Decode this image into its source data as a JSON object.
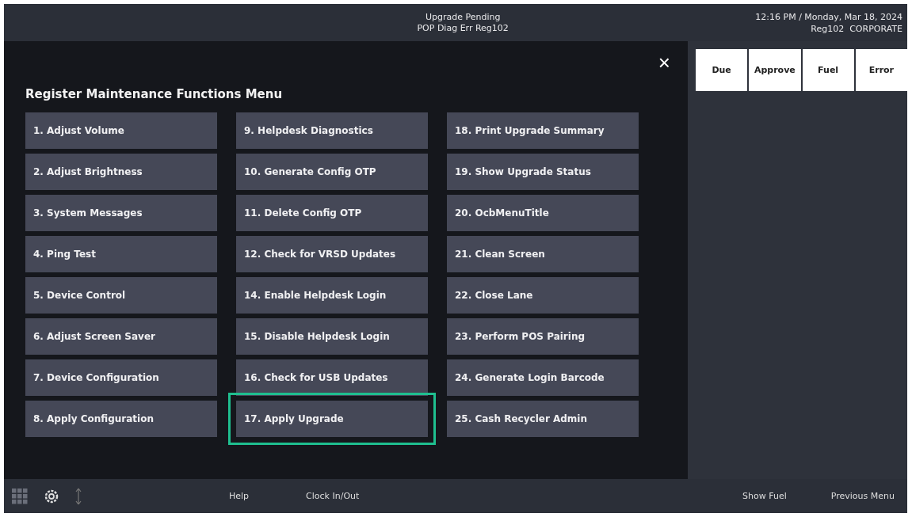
{
  "header": {
    "status_lines": [
      "Upgrade Pending",
      "POP Diag Err Reg102"
    ],
    "datetime": "12:16 PM / Monday, Mar 18, 2024",
    "register": "Reg102  CORPORATE"
  },
  "quick_buttons": [
    "Due",
    "Approve",
    "Fuel",
    "Error"
  ],
  "menu": {
    "title": "Register Maintenance Functions Menu",
    "close": "×",
    "columns": [
      [
        {
          "label": "1. Adjust Volume",
          "highlighted": false
        },
        {
          "label": "2. Adjust Brightness",
          "highlighted": false
        },
        {
          "label": "3. System Messages",
          "highlighted": false
        },
        {
          "label": "4. Ping Test",
          "highlighted": false
        },
        {
          "label": "5. Device Control",
          "highlighted": false
        },
        {
          "label": "6. Adjust Screen Saver",
          "highlighted": false
        },
        {
          "label": "7. Device Configuration",
          "highlighted": false
        },
        {
          "label": "8. Apply Configuration",
          "highlighted": false
        }
      ],
      [
        {
          "label": "9. Helpdesk Diagnostics",
          "highlighted": false
        },
        {
          "label": "10. Generate Config OTP",
          "highlighted": false
        },
        {
          "label": "11. Delete Config OTP",
          "highlighted": false
        },
        {
          "label": "12. Check for VRSD Updates",
          "highlighted": false
        },
        {
          "label": "14. Enable Helpdesk Login",
          "highlighted": false
        },
        {
          "label": "15. Disable Helpdesk Login",
          "highlighted": false
        },
        {
          "label": "16. Check for USB Updates",
          "highlighted": false
        },
        {
          "label": "17. Apply Upgrade",
          "highlighted": true
        }
      ],
      [
        {
          "label": "18. Print Upgrade Summary",
          "highlighted": false
        },
        {
          "label": "19. Show Upgrade Status",
          "highlighted": false
        },
        {
          "label": "20. OcbMenuTitle",
          "highlighted": false
        },
        {
          "label": "21. Clean Screen",
          "highlighted": false
        },
        {
          "label": "22. Close Lane",
          "highlighted": false
        },
        {
          "label": "23. Perform POS Pairing",
          "highlighted": false
        },
        {
          "label": "24. Generate Login Barcode",
          "highlighted": false
        },
        {
          "label": "25. Cash Recycler Admin",
          "highlighted": false
        }
      ]
    ]
  },
  "footer": {
    "left_buttons": [
      "Help",
      "Clock In/Out"
    ],
    "right_buttons": [
      "Show Fuel",
      "Previous Menu"
    ]
  }
}
